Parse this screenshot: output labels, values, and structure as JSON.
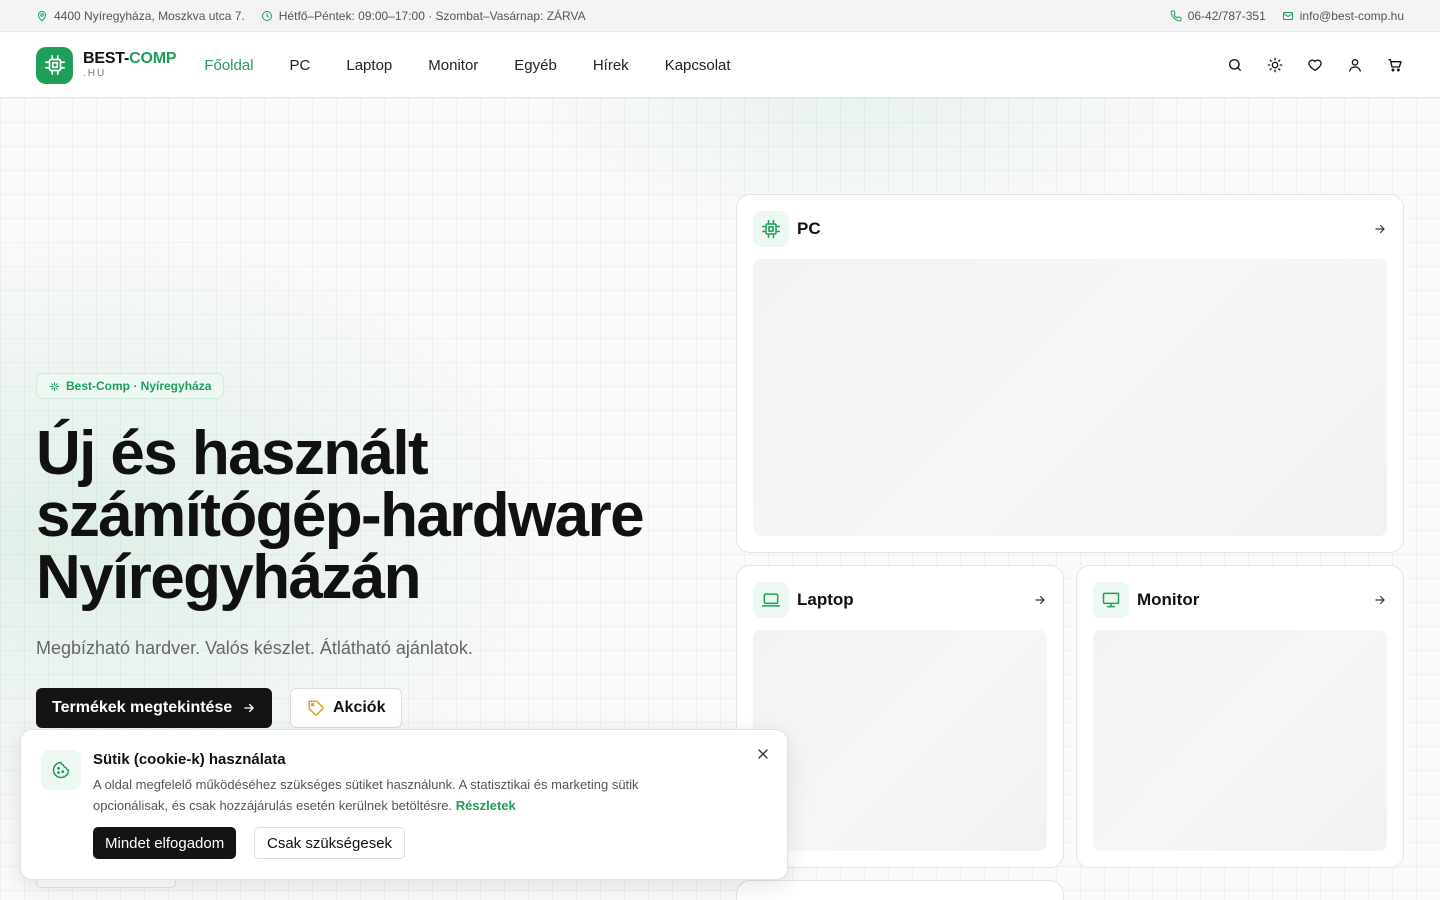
{
  "colors": {
    "accent": "#1e9e5a",
    "dark": "#141414"
  },
  "topbar": {
    "address": "4400 Nyíregyháza, Moszkva utca 7.",
    "hours": "Hétfő–Péntek: 09:00–17:00 · Szombat–Vasárnap: ZÁRVA",
    "phone": "06-42/787-351",
    "email": "info@best-comp.hu"
  },
  "logo": {
    "main": "BEST-",
    "accent": "COMP",
    "sub": ".HU"
  },
  "nav": {
    "items": [
      {
        "label": "Főoldal",
        "active": true
      },
      {
        "label": "PC"
      },
      {
        "label": "Laptop"
      },
      {
        "label": "Monitor"
      },
      {
        "label": "Egyéb"
      },
      {
        "label": "Hírek"
      },
      {
        "label": "Kapcsolat"
      }
    ]
  },
  "header_icons": [
    "search-icon",
    "theme-toggle-icon",
    "wishlist-icon",
    "account-icon",
    "cart-icon"
  ],
  "hero": {
    "badge": "Best-Comp · Nyíregyháza",
    "title_lines": [
      "Új és használt",
      "számítógép-hardware",
      "Nyíregyházán"
    ],
    "subtitle": "Megbízható hardver. Valós készlet. Átlátható ajánlatok.",
    "primary_button": "Termékek megtekintése",
    "secondary_button": "Akciók"
  },
  "categories": [
    {
      "label": "PC",
      "icon": "cpu-icon"
    },
    {
      "label": "Laptop",
      "icon": "laptop-icon"
    },
    {
      "label": "Monitor",
      "icon": "monitor-icon"
    }
  ],
  "cookie": {
    "title": "Sütik (cookie-k) használata",
    "text": "A oldal megfelelő működéséhez szükséges sütiket használunk. A statisztikai és marketing sütik opcionálisak, és csak hozzájárulás esetén kerülnek betöltésre.",
    "link": "Részletek",
    "accept": "Mindet elfogadom",
    "necessary": "Csak szükségesek"
  }
}
